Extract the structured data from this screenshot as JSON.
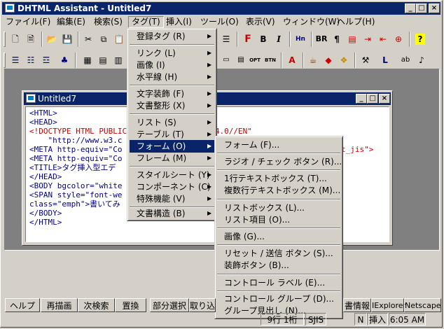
{
  "window": {
    "title": "DHTML Assistant - Untitled7",
    "min": "_",
    "max": "□",
    "close": "×"
  },
  "menubar": [
    "ファイル(F)",
    "編集(E)",
    "検索(S)",
    "タグ(T)",
    "挿入(I)",
    "ツール(O)",
    "表示(V)",
    "ウィンドウ(W)",
    "ヘルプ(H)"
  ],
  "toolbar1": {
    "bold": "B",
    "italic": "I",
    "bold_red": "F",
    "br": "BR",
    "para": "¶",
    "help": "?"
  },
  "toolbar2": {
    "opt": "OPT",
    "btn": "BTN"
  },
  "child": {
    "title": "Untitled7"
  },
  "code_lines": [
    "<HTML>",
    "<HEAD>",
    "<!DOCTYPE HTML PUBLIC \"-//W3C//DTD HTML 4.0//EN\"",
    "    \"http://www.w3.c",
    "<META http-equiv=\"Co",
    "<META http-equiv=\"Co",
    "<TITLE>タグ挿入型エデ",
    "</HEAD>",
    "<BODY bgcolor=\"white",
    "<SPAN style=\"font-we",
    "class=\"emph\">書いてみ",
    "</BODY>",
    "</HTML>"
  ],
  "code_tail": {
    "line3": "4.0//EN\"",
    "line5": "t_jis\">"
  },
  "tag_menu": {
    "items": [
      {
        "label": "登録タグ (R)",
        "arrow": "▶"
      },
      {
        "label": "リンク (L)",
        "arrow": "▶"
      },
      {
        "label": "画像 (I)",
        "arrow": "▶"
      },
      {
        "label": "水平線 (H)",
        "arrow": "▶"
      },
      {
        "label": "文字装飾 (F)",
        "arrow": "▶"
      },
      {
        "label": "文書整形 (X)",
        "arrow": "▶"
      },
      {
        "label": "リスト (S)",
        "arrow": "▶"
      },
      {
        "label": "テーブル (T)",
        "arrow": "▶"
      },
      {
        "label": "フォーム (O)",
        "arrow": "▶"
      },
      {
        "label": "フレーム (M)",
        "arrow": "▶"
      },
      {
        "label": "スタイルシート (Y)",
        "arrow": "▶"
      },
      {
        "label": "コンポーネント (C)",
        "arrow": "▶"
      },
      {
        "label": "特殊機能 (V)",
        "arrow": "▶"
      },
      {
        "label": "文書構造 (B)",
        "arrow": "▶"
      }
    ]
  },
  "form_menu": {
    "items": [
      "フォーム (F)...",
      "ラジオ / チェック ボタン (R)...",
      "1行テキストボックス (T)...",
      "複数行テキストボックス (M)...",
      "リストボックス (L)...",
      "リスト項目 (O)...",
      "画像 (G)...",
      "リセット / 送信 ボタン (S)...",
      "装飾ボタン (B)...",
      "コントロール ラベル (E)...",
      "コントロール グループ (D)...",
      "グループ見出し (N)..."
    ]
  },
  "statusbar": {
    "buttons": [
      "ヘルプ",
      "再描画",
      "次検索",
      "置換",
      "部分選択",
      "取り込"
    ],
    "right_buttons": [
      "書情報",
      "IExplorer",
      "Netscape"
    ],
    "panels": {
      "pos": "9行 1桁",
      "code": "SJIS",
      "n": "N",
      "mode": "挿入",
      "time": "6:05 AM"
    }
  }
}
